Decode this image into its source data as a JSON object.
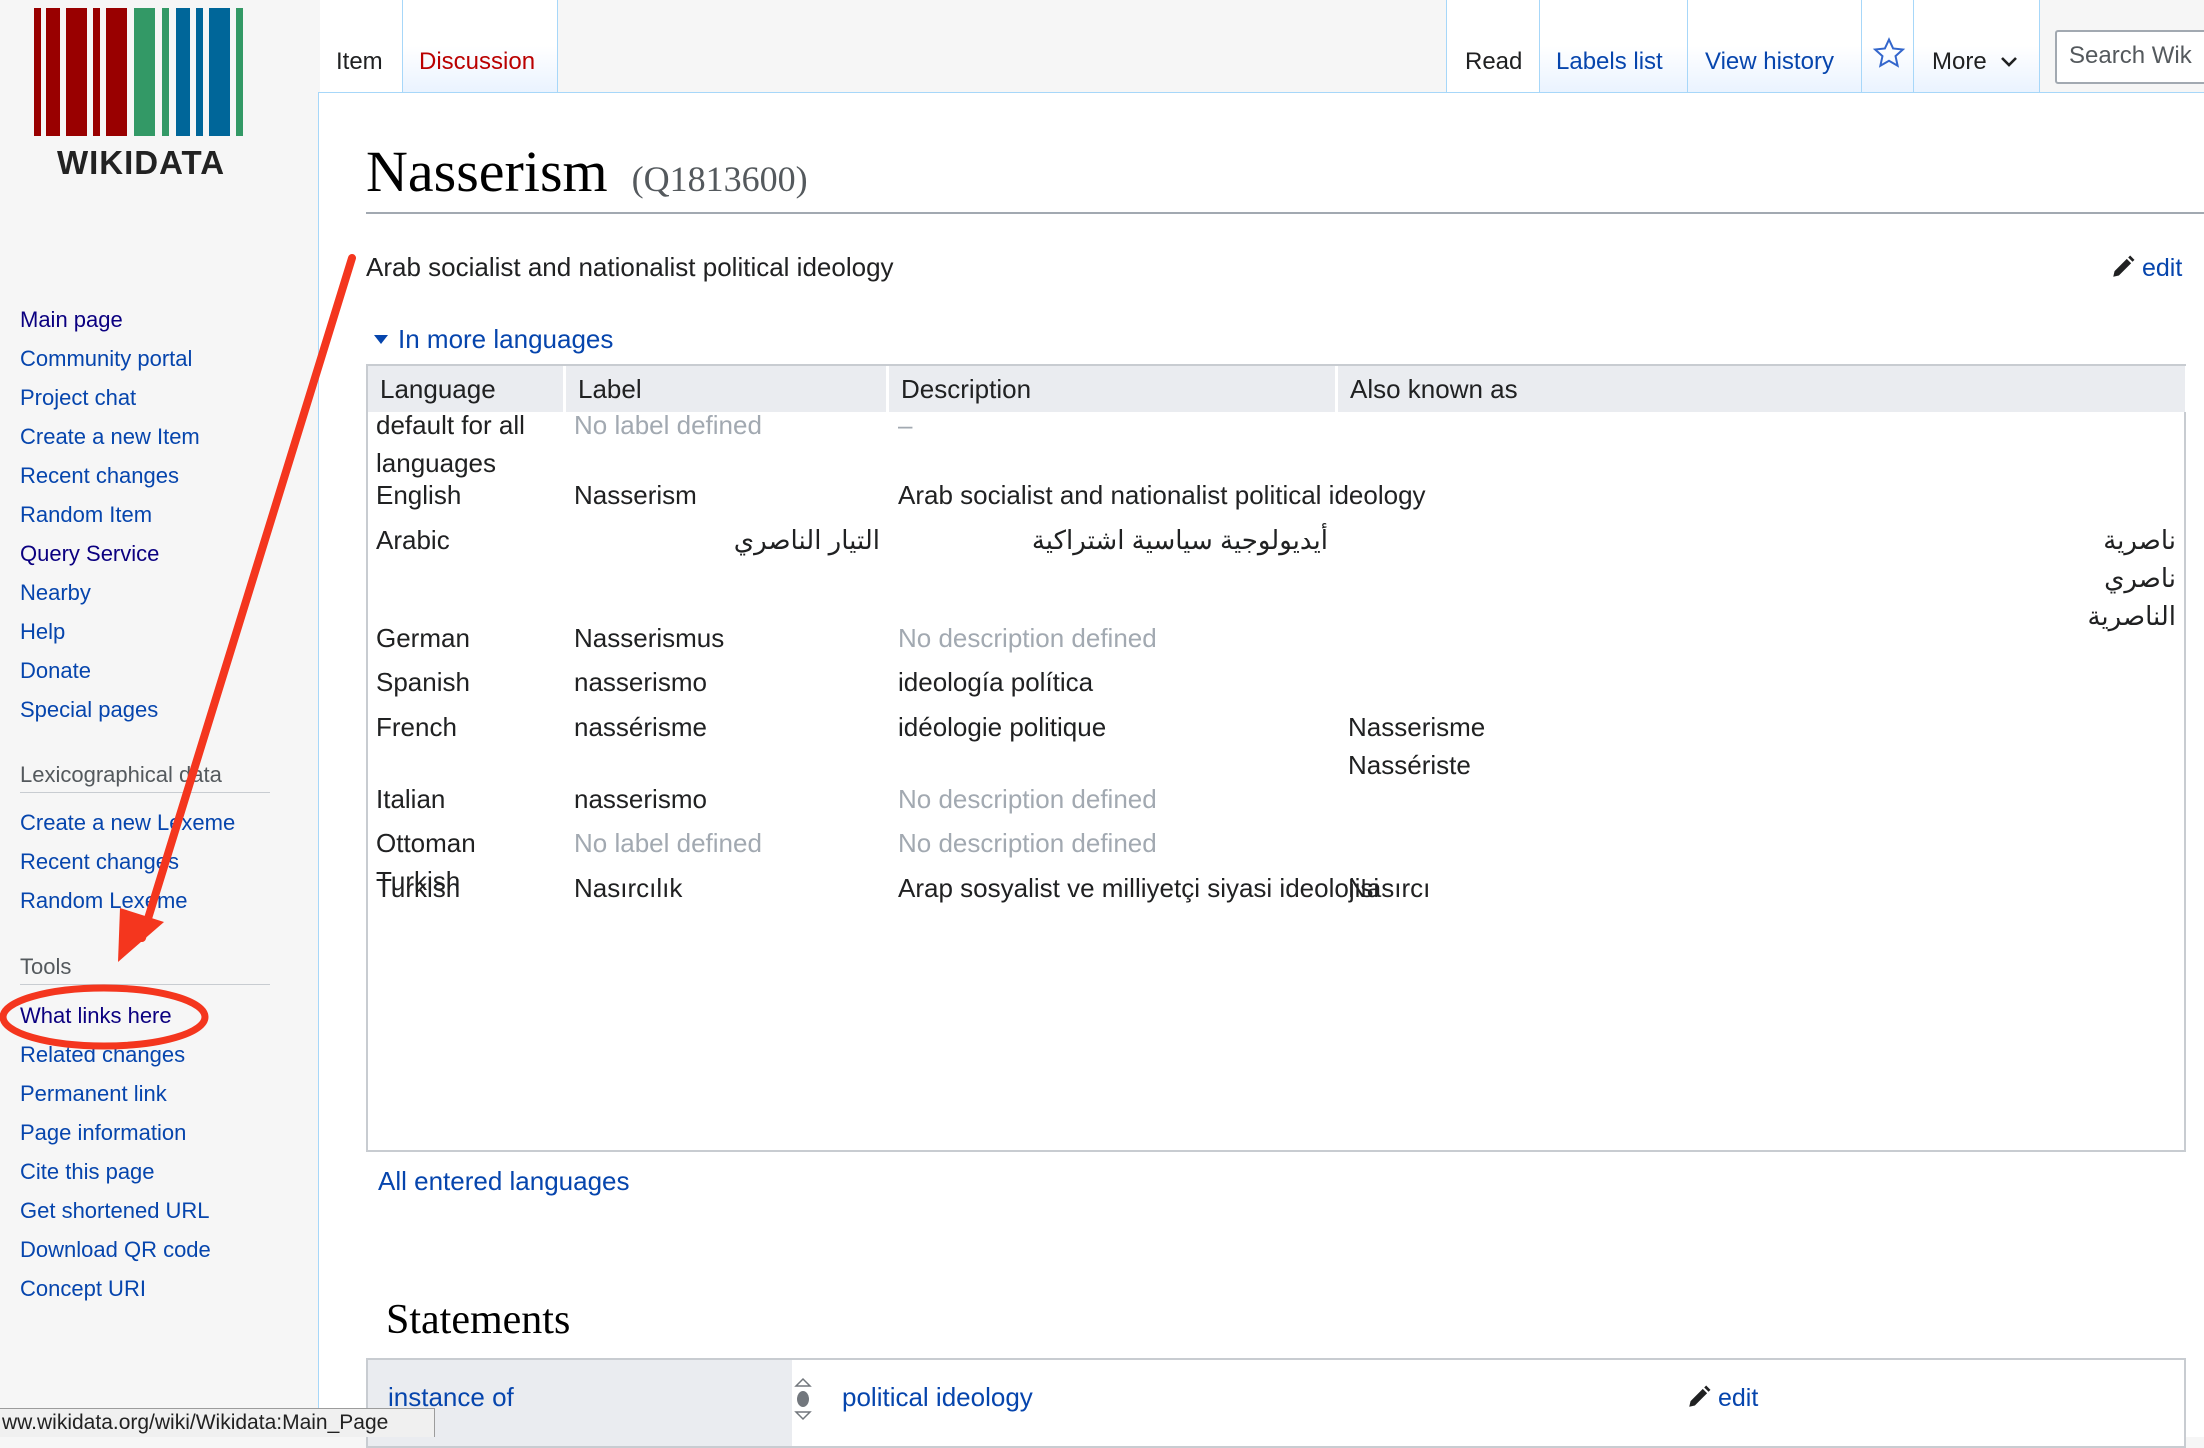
{
  "logo": {
    "text": "WIKIDATA"
  },
  "sidebar": {
    "nav": [
      {
        "label": "Main page",
        "visited": true
      },
      {
        "label": "Community portal"
      },
      {
        "label": "Project chat"
      },
      {
        "label": "Create a new Item"
      },
      {
        "label": "Recent changes"
      },
      {
        "label": "Random Item"
      },
      {
        "label": "Query Service",
        "visited": true
      },
      {
        "label": "Nearby"
      },
      {
        "label": "Help"
      },
      {
        "label": "Donate"
      },
      {
        "label": "Special pages"
      }
    ],
    "lexeme_heading": "Lexicographical data",
    "lexeme": [
      {
        "label": "Create a new Lexeme"
      },
      {
        "label": "Recent changes"
      },
      {
        "label": "Random Lexeme"
      }
    ],
    "tools_heading": "Tools",
    "tools": [
      {
        "label": "What links here",
        "visited": true
      },
      {
        "label": "Related changes"
      },
      {
        "label": "Permanent link"
      },
      {
        "label": "Page information"
      },
      {
        "label": "Cite this page"
      },
      {
        "label": "Get shortened URL"
      },
      {
        "label": "Download QR code"
      },
      {
        "label": "Concept URI"
      }
    ]
  },
  "tabs": {
    "item": "Item",
    "discussion": "Discussion",
    "read": "Read",
    "labels_list": "Labels list",
    "view_history": "View history",
    "more": "More",
    "search_placeholder": "Search Wik"
  },
  "page": {
    "title": "Nasserism",
    "qid": "(Q1813600)",
    "description": "Arab socialist and nationalist political ideology",
    "edit": "edit",
    "in_more_languages": "In more languages",
    "all_languages": "All entered languages",
    "statements_heading": "Statements"
  },
  "lang_table": {
    "headers": [
      "Language",
      "Label",
      "Description",
      "Also known as"
    ],
    "rows": [
      {
        "language": "default for all languages",
        "label": "No label defined",
        "label_missing": true,
        "description": "–",
        "description_missing": true,
        "aliases": []
      },
      {
        "language": "English",
        "label": "Nasserism",
        "description": "Arab socialist and nationalist political ideology",
        "aliases": []
      },
      {
        "language": "Arabic",
        "label": "التيار الناصري",
        "description": "أيديولوجية سياسية اشتراكية",
        "aliases": [
          "ناصرية",
          "ناصري",
          "الناصرية"
        ],
        "rtl": true
      },
      {
        "language": "German",
        "label": "Nasserismus",
        "description": "No description defined",
        "description_missing": true,
        "aliases": []
      },
      {
        "language": "Spanish",
        "label": "nasserismo",
        "description": "ideología política",
        "aliases": []
      },
      {
        "language": "French",
        "label": "nassérisme",
        "description": "idéologie politique",
        "aliases": [
          "Nasserisme",
          "Nassériste"
        ]
      },
      {
        "language": "Italian",
        "label": "nasserismo",
        "description": "No description defined",
        "description_missing": true,
        "aliases": []
      },
      {
        "language": "Ottoman Turkish",
        "label": "No label defined",
        "label_missing": true,
        "description": "No description defined",
        "description_missing": true,
        "aliases": []
      },
      {
        "language": "Turkish",
        "label": "Nasırcılık",
        "description": "Arap sosyalist ve milliyetçi siyasi ideolojisi",
        "aliases": [
          "Nasırcı"
        ]
      }
    ]
  },
  "statement": {
    "property": "instance of",
    "value": "political ideology",
    "edit": "edit"
  },
  "status_url": "ww.wikidata.org/wiki/Wikidata:Main_Page",
  "colors": {
    "link": "#0645ad",
    "visited_link": "#0b0080",
    "new_link": "#ba0000",
    "annotation": "#f4361e",
    "logo_red": "#990000",
    "logo_green": "#339966",
    "logo_blue": "#006699"
  }
}
